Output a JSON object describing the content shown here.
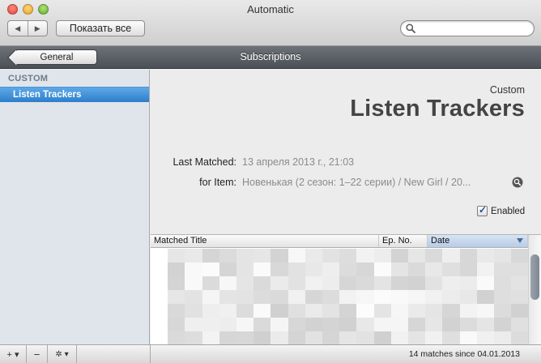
{
  "window": {
    "title": "Automatic"
  },
  "toolbar": {
    "back_glyph": "◀",
    "forward_glyph": "▶",
    "show_all_label": "Показать все",
    "search_placeholder": ""
  },
  "header": {
    "back_label": "General",
    "title": "Subscriptions"
  },
  "sidebar": {
    "heading": "CUSTOM",
    "items": [
      {
        "label": "Listen Trackers",
        "selected": true
      }
    ]
  },
  "detail": {
    "kind": "Custom",
    "title": "Listen Trackers",
    "last_matched_label": "Last Matched:",
    "last_matched_value": "13 апреля 2013 г., 21:03",
    "for_item_label": "for Item:",
    "for_item_value": "Новенькая (2 сезон: 1–22 серии) / New Girl / 20...",
    "enabled_label": "Enabled",
    "enabled": true
  },
  "table": {
    "columns": [
      "Matched Title",
      "Ep. No.",
      "Date"
    ],
    "sorted_column": "Date",
    "rows_obscured": true
  },
  "bottombar": {
    "add_glyph": "+ ▾",
    "remove_glyph": "−",
    "action_glyph": "✲ ▾",
    "status": "14 matches since  04.01.2013"
  },
  "colors": {
    "selection": "#2d7fcc",
    "header_bar": "#5a5f65",
    "sidebar_bg": "#e0e5ec"
  }
}
